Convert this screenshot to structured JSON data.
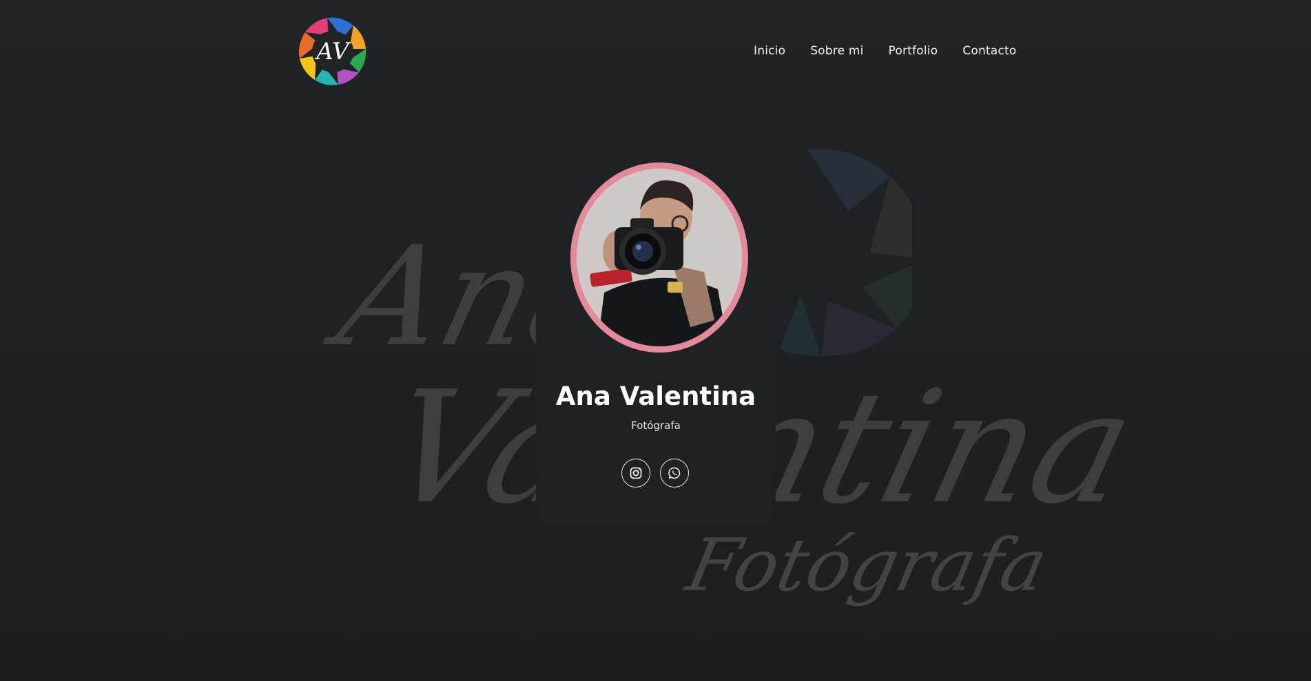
{
  "header": {
    "logo_label": "AV",
    "nav": [
      {
        "label": "Inicio"
      },
      {
        "label": "Sobre mi"
      },
      {
        "label": "Portfolio"
      },
      {
        "label": "Contacto"
      }
    ]
  },
  "background": {
    "watermark_line1": "Ana",
    "watermark_line2": "Valentina",
    "watermark_line3": "Fotógrafa"
  },
  "profile": {
    "name": "Ana Valentina",
    "role": "Fotógrafa",
    "accent_color": "#e58a9b",
    "socials": [
      {
        "icon": "instagram-icon"
      },
      {
        "icon": "whatsapp-icon"
      }
    ]
  }
}
